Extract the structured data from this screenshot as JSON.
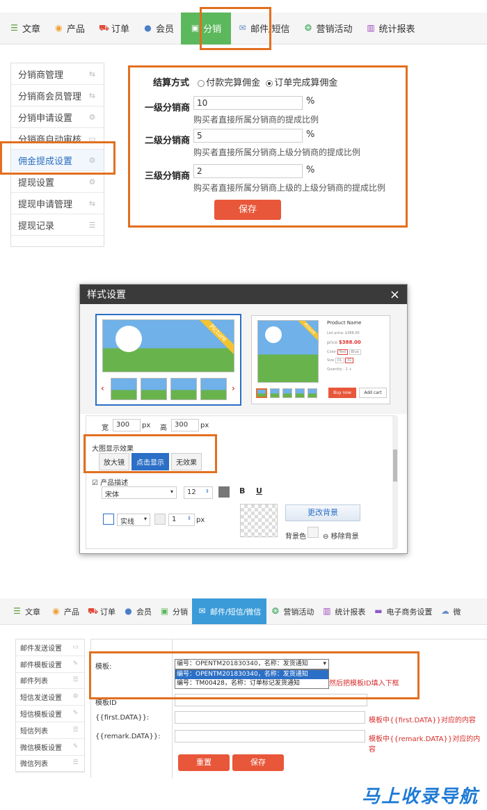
{
  "nav1": {
    "items": [
      {
        "icon": "list-icon",
        "label": "文章"
      },
      {
        "icon": "map-pin-icon",
        "label": "产品"
      },
      {
        "icon": "cart-icon",
        "label": "订单"
      },
      {
        "icon": "user-icon",
        "label": "会员"
      },
      {
        "icon": "distribution-icon",
        "label": "分销"
      },
      {
        "icon": "mail-icon",
        "label": "邮件/短信"
      },
      {
        "icon": "campaign-icon",
        "label": "营销活动"
      },
      {
        "icon": "bar-chart-icon",
        "label": "统计报表"
      }
    ],
    "active_index": 4
  },
  "sidebar1": {
    "items": [
      "分销商管理",
      "分销商会员管理",
      "分销申请设置",
      "分销商自动审核",
      "佣金提成设置",
      "提现设置",
      "提现申请管理",
      "提现记录"
    ],
    "active_index": 4
  },
  "commission_form": {
    "settle_label": "结算方式",
    "settle_opt1": "付款完算佣金",
    "settle_opt2": "订单完成算佣金",
    "level1_label": "一级分销商",
    "level1_value": "10",
    "level1_hint": "购买者直接所属分销商的提成比例",
    "level2_label": "二级分销商",
    "level2_value": "5",
    "level2_hint": "购买者直接所属分销商上级分销商的提成比例",
    "level3_label": "三级分销商",
    "level3_value": "2",
    "level3_hint": "购买者直接所属分销商上级的上级分销商的提成比例",
    "percent": "%",
    "save": "保存"
  },
  "dialog": {
    "title": "样式设置",
    "close": "×",
    "badge": "Picture",
    "product_name": "Product Name",
    "list_price": "List price: $388.00",
    "price_label": "price",
    "price": "$388.00",
    "color_label": "Color",
    "color_opt1": "Red",
    "color_opt2": "Blue",
    "size_label": "Size",
    "size_opt1": "DL",
    "size_opt2": "XL",
    "qty_label": "Quantity",
    "qty_value": "1",
    "buy_now": "Buy now",
    "add_cart": "Add cart",
    "width_label": "宽",
    "width_value": "300",
    "height_label": "高",
    "height_value": "300",
    "px": "px",
    "effect_title": "大图显示效果",
    "effect_opts": [
      "放大镜",
      "点击显示",
      "无效果"
    ],
    "effect_active": 1,
    "desc_label": "产品描述",
    "font_value": "宋体",
    "font_size": "12",
    "bold": "B",
    "underline": "U",
    "border_style": "实线",
    "border_width": "1",
    "change_bg": "更改背景",
    "bg_color_label": "背景色",
    "remove_bg": "移除背景"
  },
  "nav2": {
    "items": [
      {
        "icon": "list-icon",
        "label": "文章"
      },
      {
        "icon": "map-pin-icon",
        "label": "产品"
      },
      {
        "icon": "cart-icon",
        "label": "订单"
      },
      {
        "icon": "user-icon",
        "label": "会员"
      },
      {
        "icon": "distribution-icon",
        "label": "分销"
      },
      {
        "icon": "mail-icon",
        "label": "邮件/短信/微信"
      },
      {
        "icon": "campaign-icon",
        "label": "营销活动"
      },
      {
        "icon": "bar-chart-icon",
        "label": "统计报表"
      },
      {
        "icon": "shop-icon",
        "label": "电子商务设置"
      },
      {
        "icon": "wechat-icon",
        "label": "微"
      }
    ],
    "active_index": 5
  },
  "sidebar2": {
    "items": [
      "邮件发送设置",
      "邮件模板设置",
      "邮件列表",
      "短信发送设置",
      "短信模板设置",
      "短信列表",
      "微信模板设置",
      "微信列表"
    ]
  },
  "template_form": {
    "template_label": "模板:",
    "selected": "编号：OPENTM201830340，名称：发货通知",
    "options": [
      "编号：OPENTM201830340，名称：发货通知",
      "编号：TM00428，名称：订单标记发货通知"
    ],
    "side_hint": "然后把模板ID填入下框",
    "template_id_label": "模板ID",
    "first_label": "{{first.DATA}}:",
    "first_hint": "模板中{{first.DATA}}对应的内容",
    "remark_label": "{{remark.DATA}}:",
    "remark_hint": "模板中{{remark.DATA}}对应的内容",
    "reset": "重置",
    "save": "保存"
  },
  "watermark": "马上收录导航"
}
